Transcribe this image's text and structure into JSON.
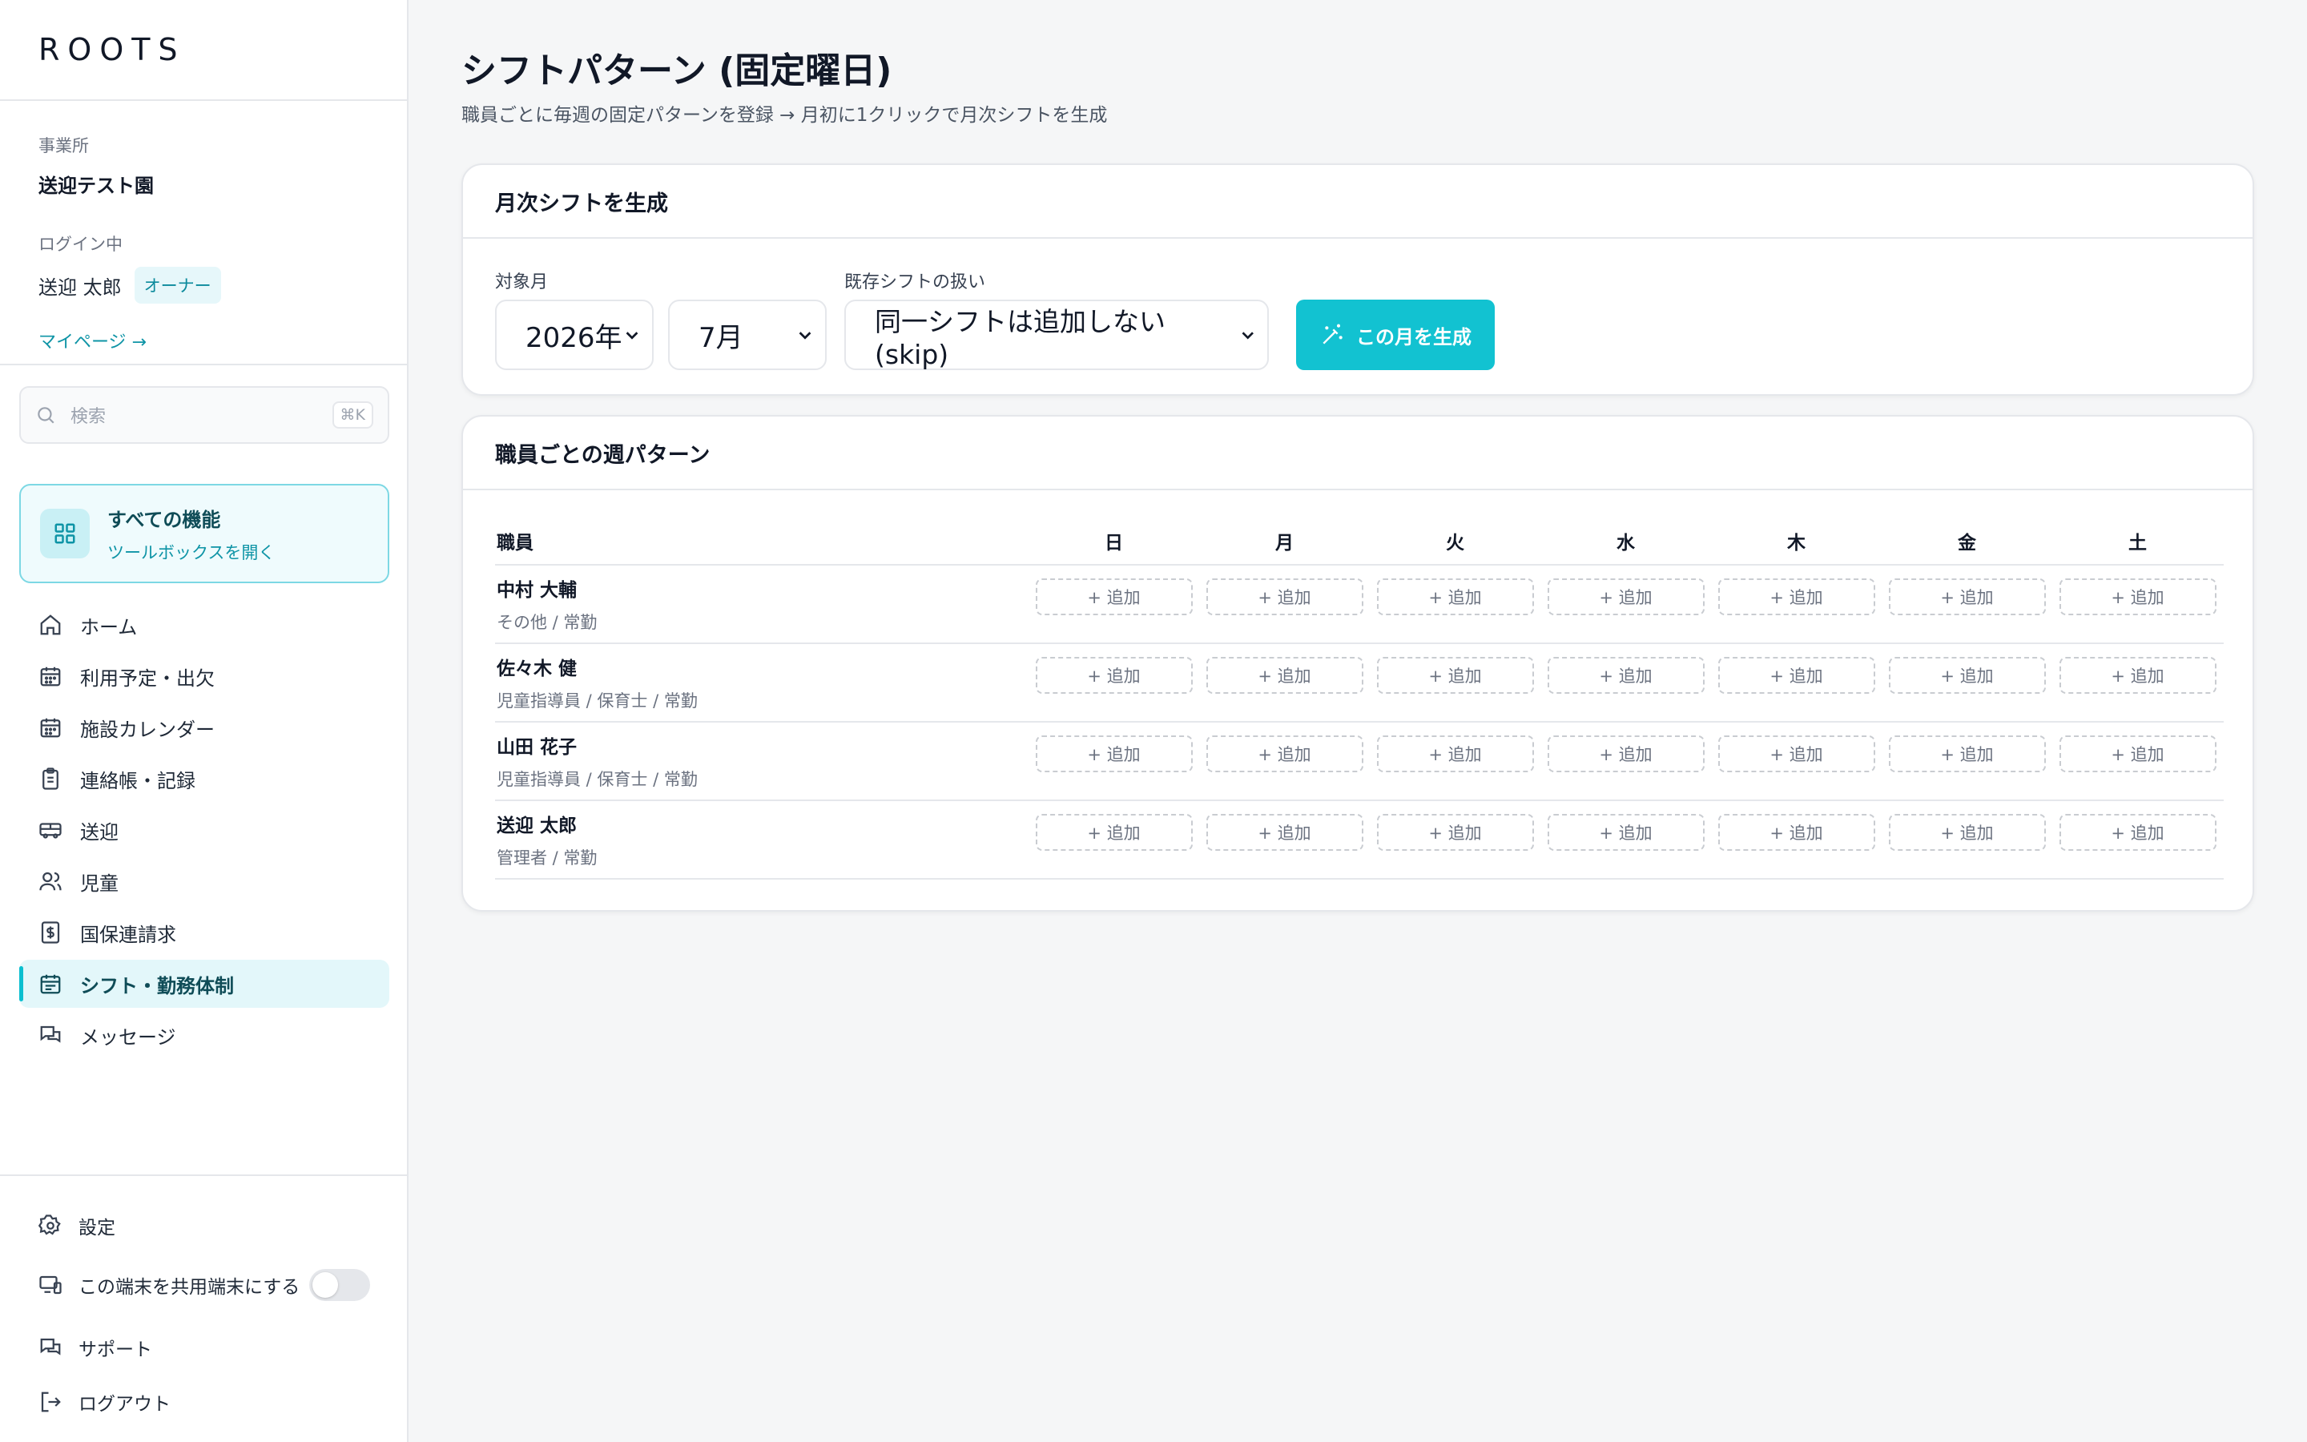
{
  "brand": "ROOTS",
  "facility": {
    "label": "事業所",
    "name": "送迎テスト園",
    "login_label": "ログイン中",
    "user_name": "送迎 太郎",
    "role": "オーナー",
    "mypage": "マイページ →"
  },
  "search": {
    "placeholder": "検索",
    "shortcut": "⌘K"
  },
  "all_features": {
    "title": "すべての機能",
    "sub": "ツールボックスを開く"
  },
  "nav": [
    {
      "label": "ホーム",
      "icon": "home-icon"
    },
    {
      "label": "利用予定・出欠",
      "icon": "calendar-icon"
    },
    {
      "label": "施設カレンダー",
      "icon": "calendar-icon"
    },
    {
      "label": "連絡帳・記録",
      "icon": "clipboard-icon"
    },
    {
      "label": "送迎",
      "icon": "bus-icon"
    },
    {
      "label": "児童",
      "icon": "users-icon"
    },
    {
      "label": "国保連請求",
      "icon": "receipt-icon"
    },
    {
      "label": "シフト・勤務体制",
      "icon": "calendar-clock-icon",
      "active": true
    },
    {
      "label": "メッセージ",
      "icon": "messages-icon"
    }
  ],
  "bottom": {
    "settings": "設定",
    "shared_device": "この端末を共用端末にする",
    "support": "サポート",
    "logout": "ログアウト"
  },
  "page": {
    "title": "シフトパターン (固定曜日)",
    "subtitle": "職員ごとに毎週の固定パターンを登録 → 月初に1クリックで月次シフトを生成"
  },
  "generate": {
    "header": "月次シフトを生成",
    "month_label": "対象月",
    "year_value": "2026年",
    "month_value": "7月",
    "existing_label": "既存シフトの扱い",
    "existing_value": "同一シフトは追加しない (skip)",
    "button": "この月を生成"
  },
  "patterns": {
    "header": "職員ごとの週パターン",
    "col_staff": "職員",
    "days": [
      "日",
      "月",
      "火",
      "水",
      "木",
      "金",
      "土"
    ],
    "add_label": "+ 追加",
    "staff": [
      {
        "name": "中村 大輔",
        "role": "その他 / 常勤"
      },
      {
        "name": "佐々木 健",
        "role": "児童指導員 / 保育士 / 常勤"
      },
      {
        "name": "山田 花子",
        "role": "児童指導員 / 保育士 / 常勤"
      },
      {
        "name": "送迎 太郎",
        "role": "管理者 / 常勤"
      }
    ]
  },
  "colors": {
    "accent": "#12c2d1",
    "active_bg": "#e3f7fa"
  }
}
